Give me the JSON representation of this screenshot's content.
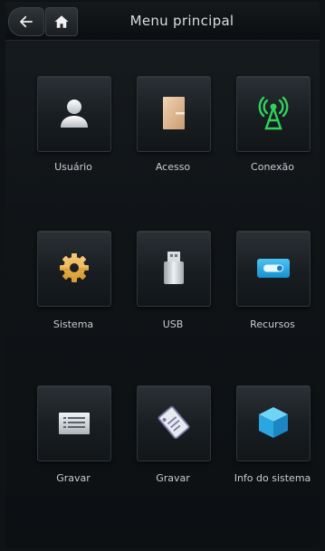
{
  "header": {
    "title": "Menu principal",
    "back_icon": "back-arrow-icon",
    "home_icon": "home-icon"
  },
  "menu": {
    "items": [
      {
        "label": "Usuário",
        "icon": "user-icon"
      },
      {
        "label": "Acesso",
        "icon": "door-icon"
      },
      {
        "label": "Conexão",
        "icon": "antenna-icon"
      },
      {
        "label": "Sistema",
        "icon": "gear-icon"
      },
      {
        "label": "USB",
        "icon": "usb-icon"
      },
      {
        "label": "Recursos",
        "icon": "toggle-icon"
      },
      {
        "label": "Gravar",
        "icon": "record-list-icon"
      },
      {
        "label": "Gravar",
        "icon": "scroll-record-icon"
      },
      {
        "label": "Info do sistema",
        "icon": "cube-icon"
      }
    ]
  },
  "colors": {
    "background": "#0f1316",
    "accent_green": "#2fd35a",
    "accent_blue": "#26a8e6"
  }
}
